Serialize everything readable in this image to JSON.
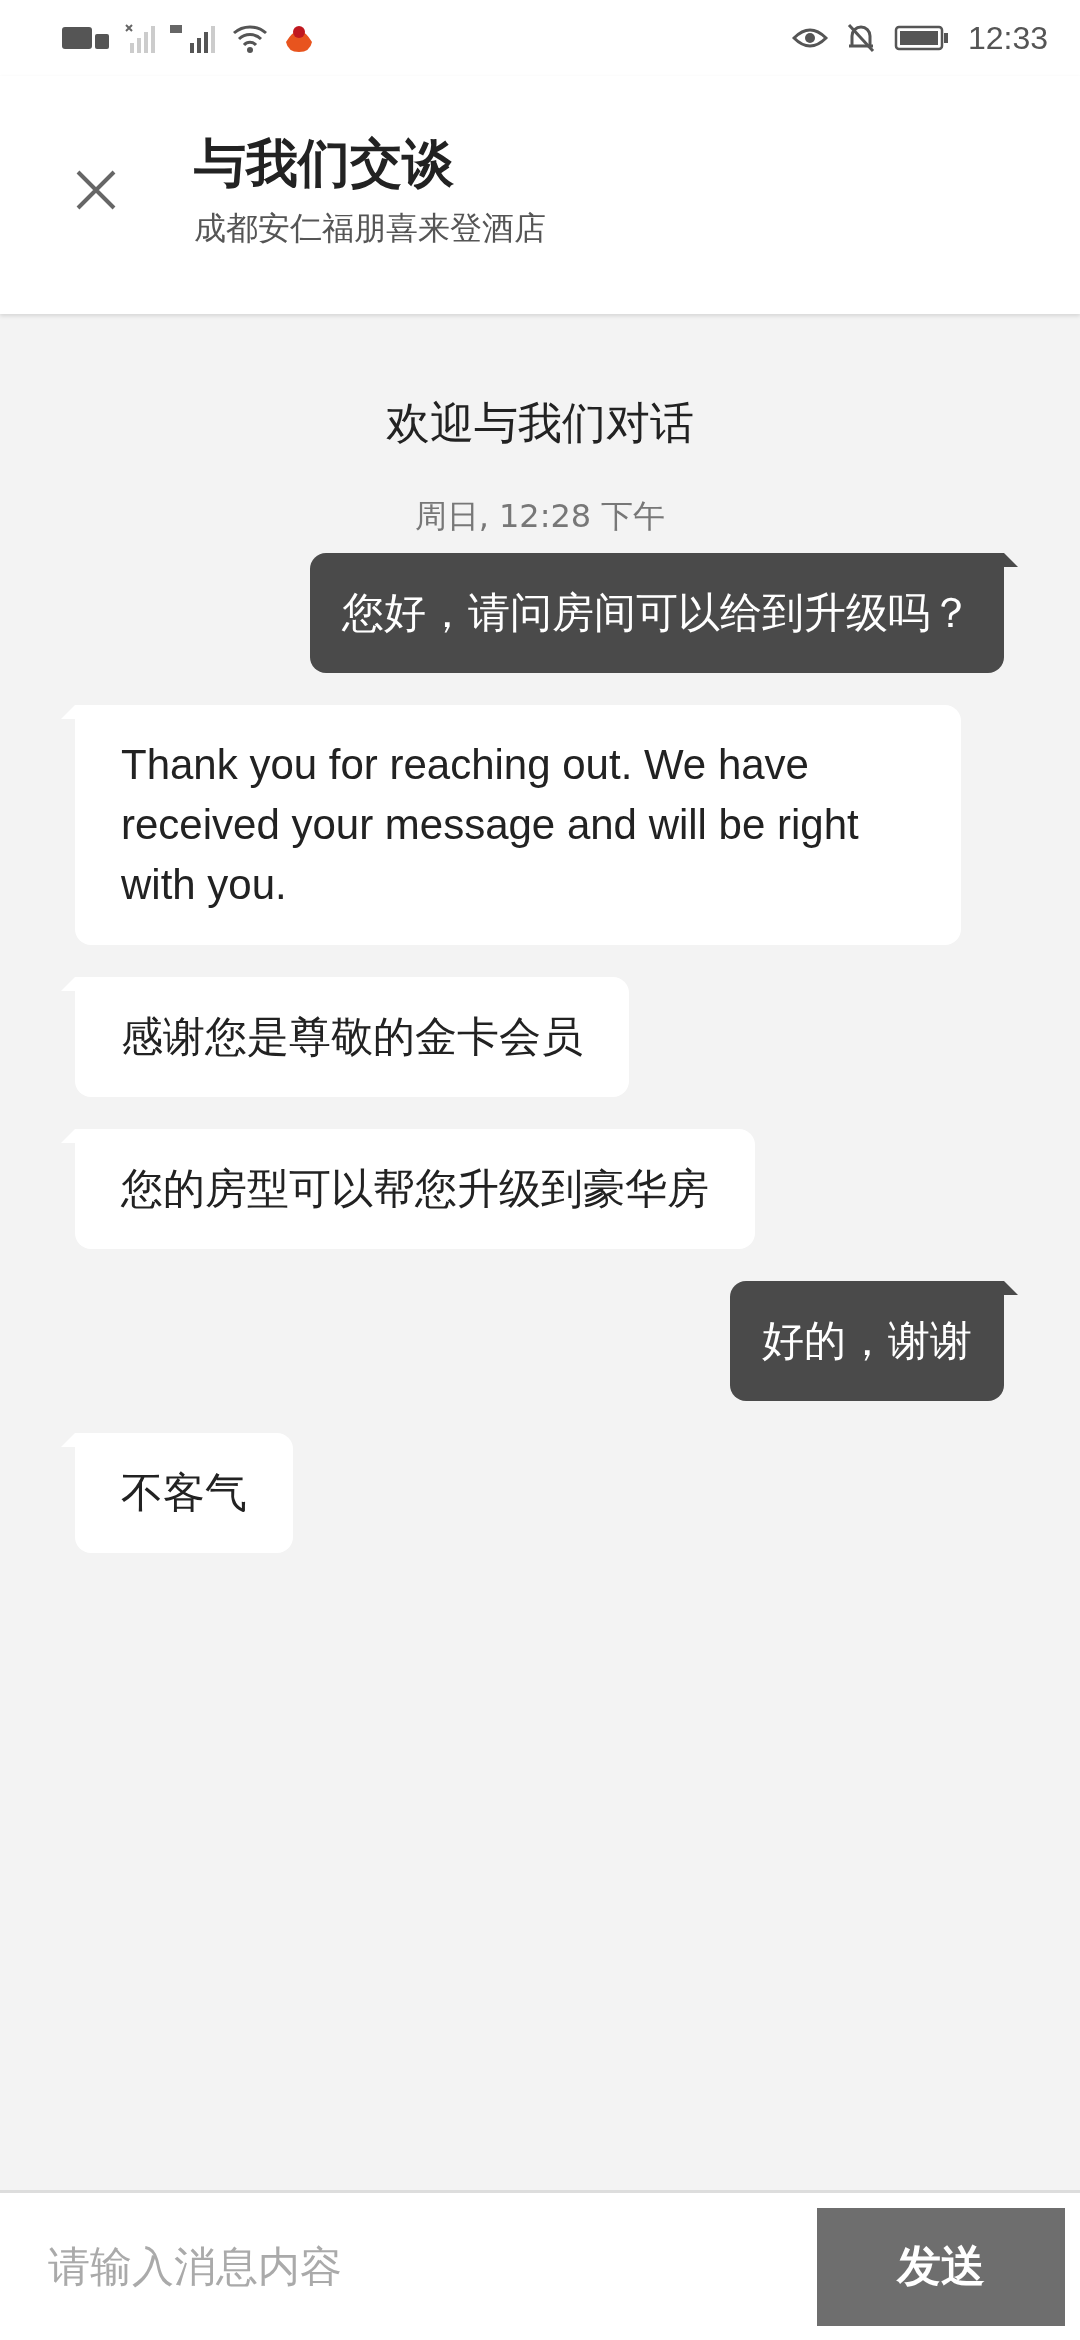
{
  "status_bar": {
    "time": "12:33"
  },
  "header": {
    "title": "与我们交谈",
    "subtitle": "成都安仁福朋喜来登酒店"
  },
  "chat": {
    "welcome": "欢迎与我们对话",
    "timestamp": "周日, 12:28 下午",
    "messages": [
      {
        "kind": "out",
        "text": "您好，请问房间可以给到升级吗？"
      },
      {
        "kind": "in",
        "text": "Thank you for reaching out. We have received your message and will be right with you."
      },
      {
        "kind": "in",
        "text": "感谢您是尊敬的金卡会员"
      },
      {
        "kind": "in",
        "text": "您的房型可以帮您升级到豪华房"
      },
      {
        "kind": "out",
        "text": "好的，谢谢"
      },
      {
        "kind": "in",
        "text": "不客气"
      }
    ]
  },
  "composer": {
    "placeholder": "请输入消息内容",
    "send": "发送"
  }
}
